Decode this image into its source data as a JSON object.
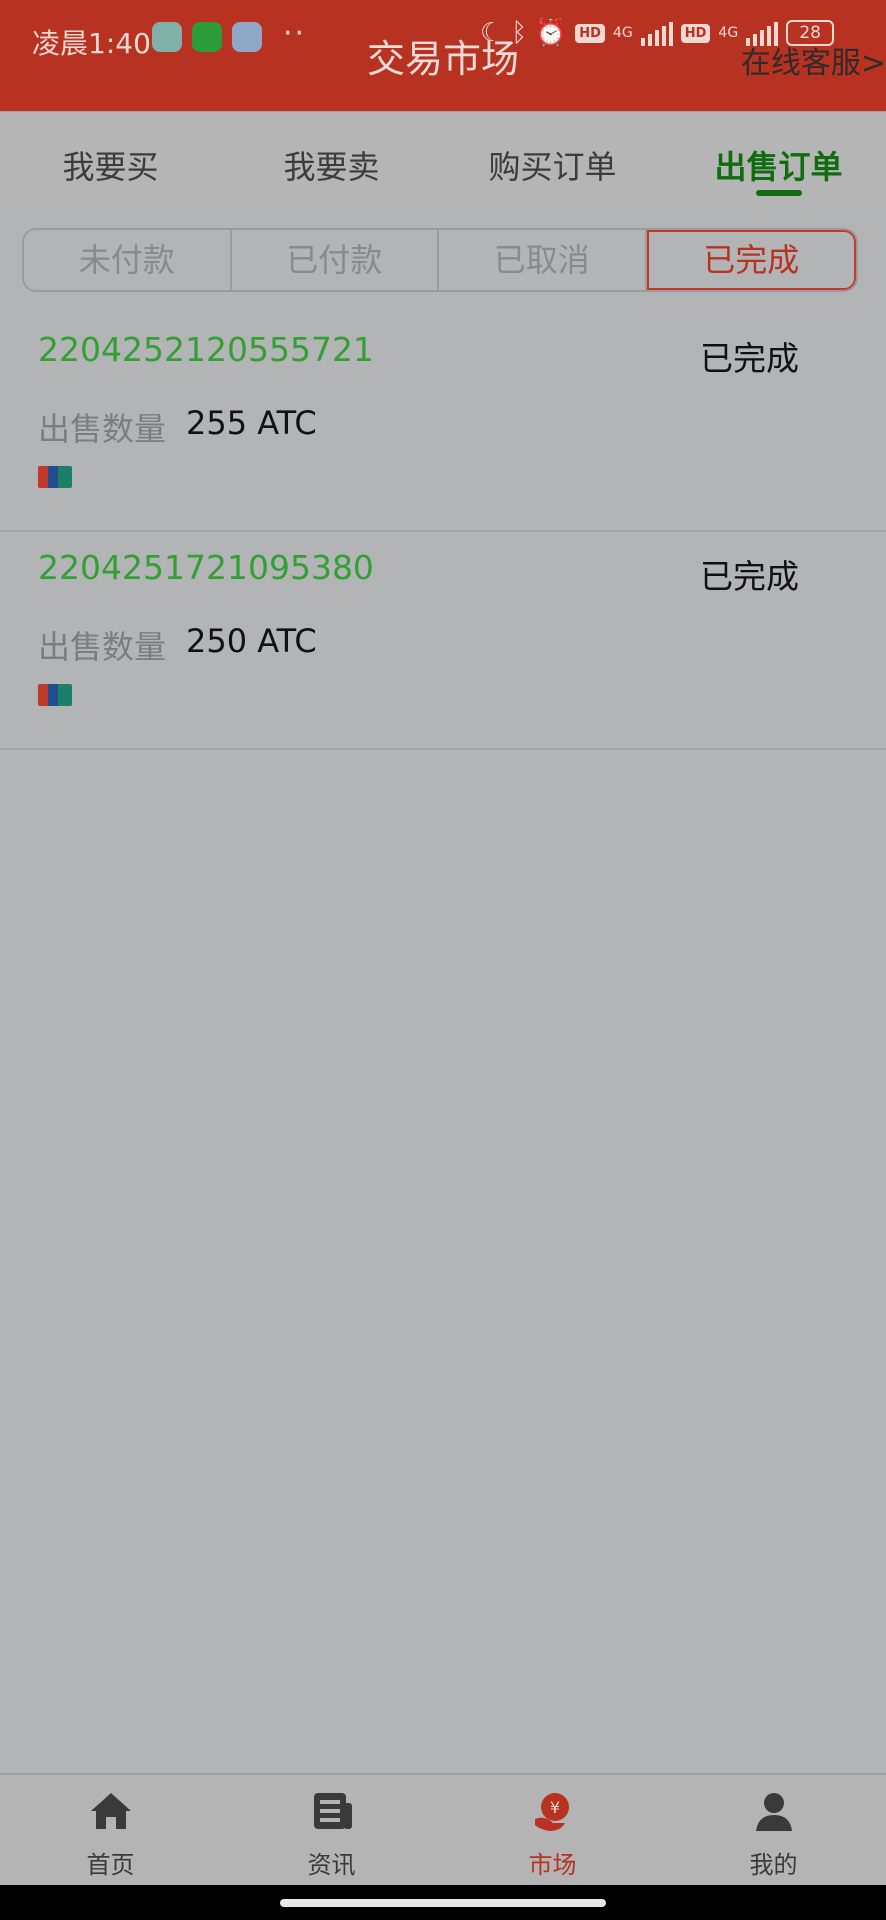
{
  "status_bar": {
    "time": "凌晨1:40",
    "dots": "··",
    "network_1": "4G",
    "network_2": "4G",
    "hd_1": "HD",
    "hd_2": "HD",
    "battery": "28",
    "app_icons": [
      "maps-app-icon",
      "wechat-icon",
      "browser-app-icon"
    ]
  },
  "header": {
    "title": "交易市场",
    "service_link": "在线客服>",
    "background": "#b83222"
  },
  "tabs": [
    {
      "label": "我要买"
    },
    {
      "label": "我要卖"
    },
    {
      "label": "购买订单"
    },
    {
      "label": "出售订单",
      "active": true
    }
  ],
  "segments": [
    {
      "label": "未付款"
    },
    {
      "label": "已付款"
    },
    {
      "label": "已取消"
    },
    {
      "label": "已完成",
      "active": true
    }
  ],
  "orders": [
    {
      "id": "2204252120555721",
      "status": "已完成",
      "qty_label": "出售数量",
      "qty": "255 ATC",
      "payment_icon": "unionpay-icon"
    },
    {
      "id": "2204251721095380",
      "status": "已完成",
      "qty_label": "出售数量",
      "qty": "250 ATC",
      "payment_icon": "unionpay-icon"
    }
  ],
  "bottom_nav": [
    {
      "label": "首页",
      "icon": "home-icon"
    },
    {
      "label": "资讯",
      "icon": "news-icon"
    },
    {
      "label": "市场",
      "icon": "market-icon",
      "active": true
    },
    {
      "label": "我的",
      "icon": "profile-icon"
    }
  ],
  "colors": {
    "accent_red": "#b83222",
    "active_green": "#0f6d0f",
    "order_id_green": "#34a034"
  }
}
